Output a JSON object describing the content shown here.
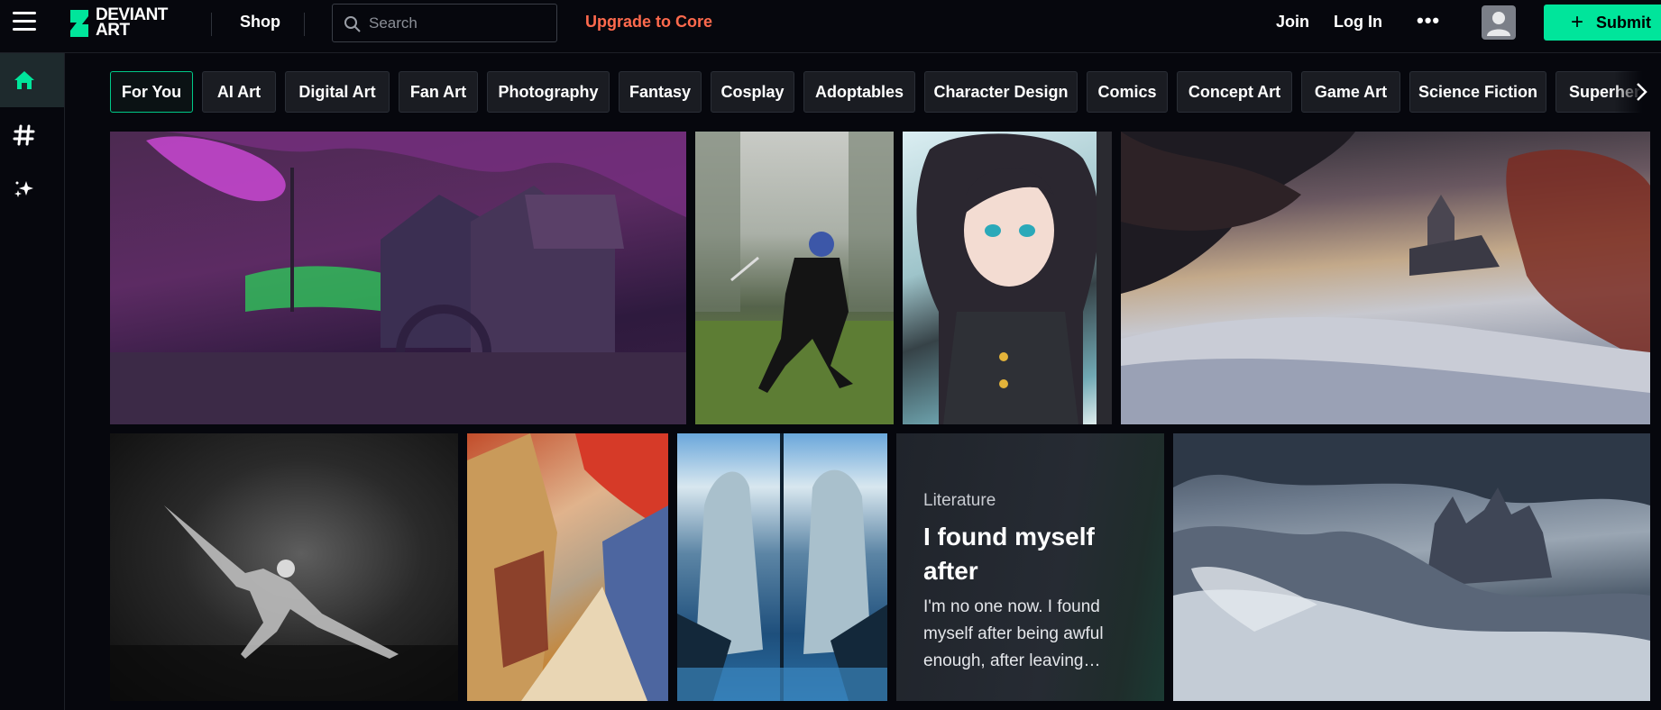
{
  "header": {
    "logo_line1": "DEVIANT",
    "logo_line2": "ART",
    "shop_label": "Shop",
    "search_placeholder": "Search",
    "upgrade_label": "Upgrade to Core",
    "join_label": "Join",
    "login_label": "Log In",
    "more_label": "•••",
    "submit_label": "Submit",
    "accent_color": "#00e59b",
    "upgrade_color": "#ff6a4d"
  },
  "sidebar": {
    "items": [
      {
        "name": "home",
        "icon": "home-icon",
        "active": true
      },
      {
        "name": "tags",
        "icon": "hashtag-icon",
        "active": false
      },
      {
        "name": "sparkle",
        "icon": "sparkle-icon",
        "active": false
      }
    ]
  },
  "categories": [
    "For You",
    "AI Art",
    "Digital Art",
    "Fan Art",
    "Photography",
    "Fantasy",
    "Cosplay",
    "Adoptables",
    "Character Design",
    "Comics",
    "Concept Art",
    "Game Art",
    "Science Fiction",
    "Superhero"
  ],
  "active_category": "For You",
  "literature_card": {
    "category": "Literature",
    "title": "I found myself after",
    "excerpt": "I'm no one now. I found myself after being awful enough, after leaving…"
  }
}
